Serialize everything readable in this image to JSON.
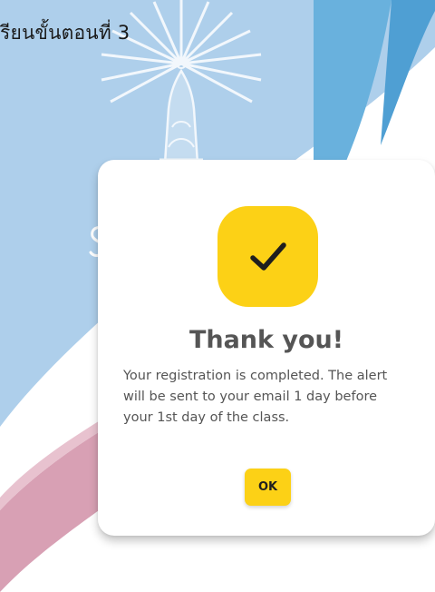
{
  "page": {
    "step_title": "รียนขั้นตอนที่ 3"
  },
  "dialog": {
    "icon": "checkmark-icon",
    "title": "Thank you!",
    "message": "Your registration is completed. The alert will be sent to your email 1 day before your 1st day of the class.",
    "ok_label": "OK"
  },
  "colors": {
    "accent_yellow": "#fcd116",
    "light_blue": "#a8cce9",
    "mid_blue": "#6ab0dc",
    "pink": "#d49aae",
    "text_gray": "#555555"
  }
}
